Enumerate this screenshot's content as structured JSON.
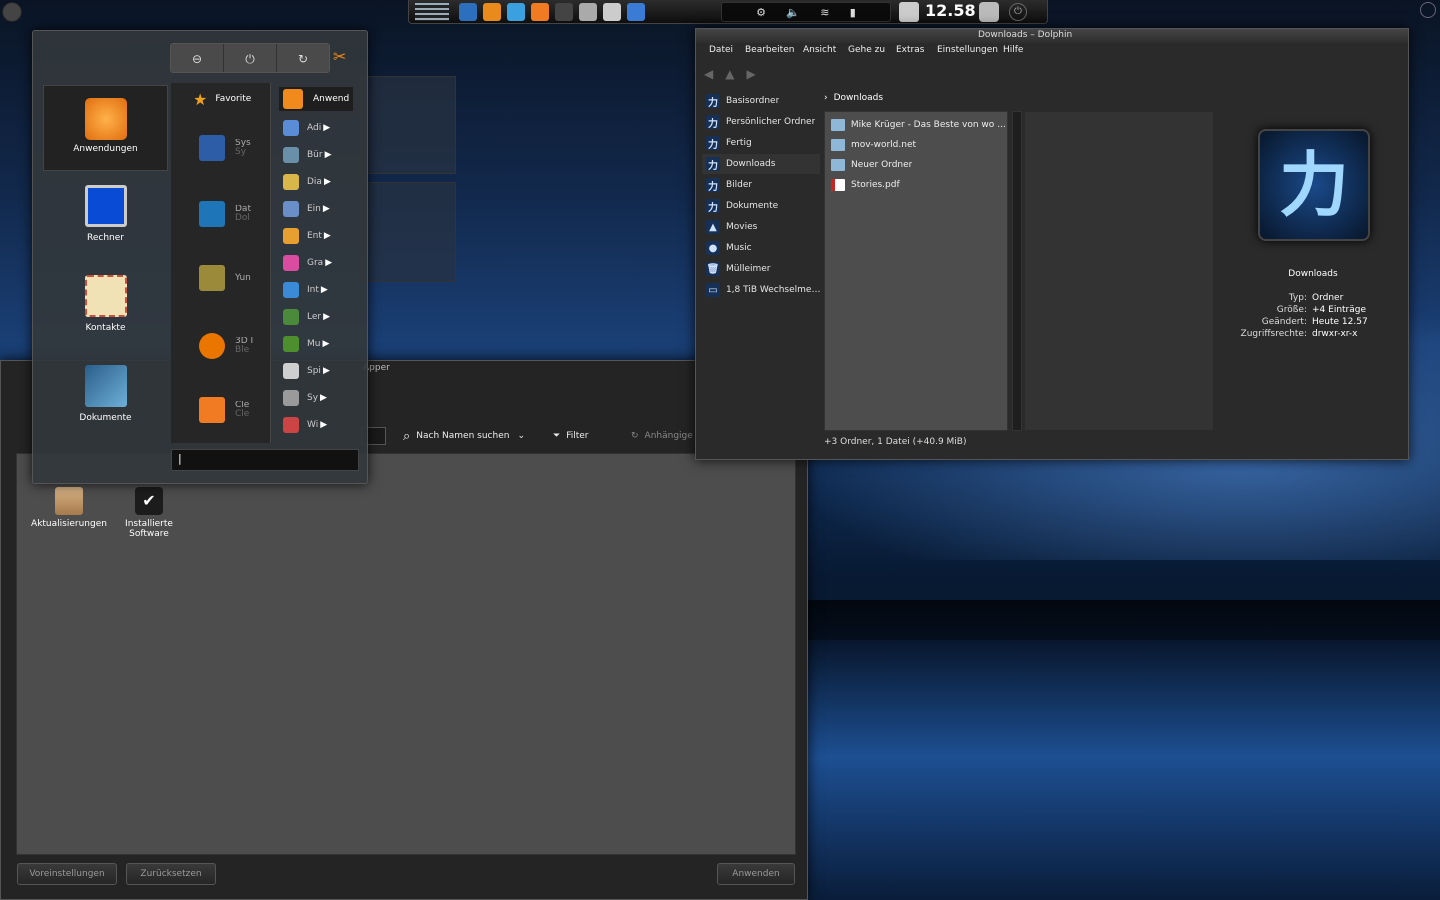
{
  "taskbar": {
    "clock": "12.58",
    "launchers": [
      "browser-icon",
      "package-icon",
      "file-manager-icon",
      "media-icon",
      "terminal-icon",
      "disk-icon",
      "mixer-icon",
      "tools-icon"
    ],
    "tray": [
      "settings-icon",
      "volume-icon",
      "wifi-icon",
      "battery-icon"
    ]
  },
  "launcher": {
    "tabs": [
      {
        "label": "Anwendungen"
      },
      {
        "label": "Rechner"
      },
      {
        "label": "Kontakte"
      },
      {
        "label": "Dokumente"
      }
    ],
    "categories": [
      {
        "label": "Favorite"
      },
      {
        "label": "Sys",
        "sub": "Sy"
      },
      {
        "label": "Dat",
        "sub": "Dol"
      },
      {
        "label": "Yun"
      },
      {
        "label": "3D I",
        "sub": "Ble"
      },
      {
        "label": "Cle",
        "sub": "Cle"
      }
    ],
    "apps_header": "Anwend",
    "apps": [
      "Adi",
      "Bür",
      "Dia",
      "Ein",
      "Ent",
      "Gra",
      "Int",
      "Ler",
      "Mu",
      "Spi",
      "Sy",
      "Wi"
    ],
    "search_text": "|"
  },
  "dolphin": {
    "title": "Downloads – Dolphin",
    "menu": [
      "Datei",
      "Bearbeiten",
      "Ansicht",
      "Gehe zu",
      "Extras",
      "Einstellungen",
      "Hilfe"
    ],
    "places": [
      {
        "label": "Basisordner"
      },
      {
        "label": "Persönlicher Ordner"
      },
      {
        "label": "Fertig"
      },
      {
        "label": "Downloads"
      },
      {
        "label": "Bilder"
      },
      {
        "label": "Dokumente"
      },
      {
        "label": "Movies"
      },
      {
        "label": "Music"
      },
      {
        "label": "Mülleimer"
      },
      {
        "label": "1,8 TiB Wechselme…"
      }
    ],
    "breadcrumb": "Downloads",
    "files": [
      "Mike Krüger - Das Beste von wo …",
      "mov-world.net",
      "Neuer Ordner",
      "Stories.pdf"
    ],
    "status": "+3 Ordner, 1 Datei (+40.9 MiB)",
    "info": {
      "name": "Downloads",
      "rows": [
        {
          "k": "Typ:",
          "v": "Ordner"
        },
        {
          "k": "Größe:",
          "v": "+4 Einträge"
        },
        {
          "k": "Geändert:",
          "v": "Heute 12.57"
        },
        {
          "k": "Zugriffsrechte:",
          "v": "drwxr-xr-x"
        }
      ]
    }
  },
  "apper": {
    "title": "Apper",
    "search_mode": "Nach Namen suchen",
    "filter": "Filter",
    "pending": "Anhängige Änderungen",
    "icons": [
      {
        "label": "Aktualisierungen"
      },
      {
        "label": "Installierte Software"
      }
    ],
    "defaults": "Voreinstellungen",
    "reset": "Zurücksetzen",
    "apply": "Anwenden"
  },
  "colors": {
    "accent": "#f08a1c",
    "panel": "#2b2b2b",
    "selection": "#3d3d3d"
  }
}
